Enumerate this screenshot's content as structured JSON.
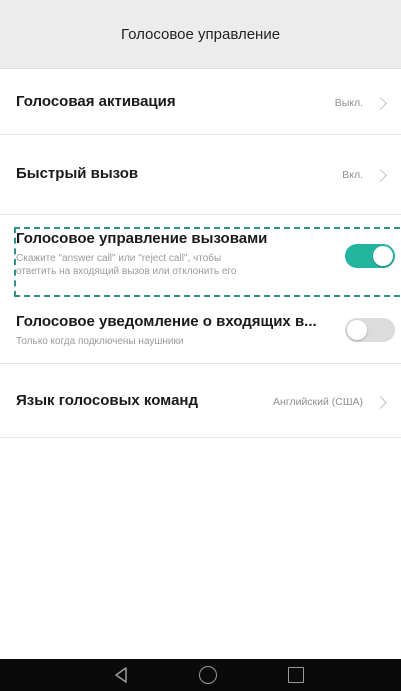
{
  "header": {
    "title": "Голосовое управление"
  },
  "rows": [
    {
      "title": "Голосовая активация",
      "value": "Выкл."
    },
    {
      "title": "Быстрый вызов",
      "value": "Вкл."
    },
    {
      "title": "Голосовое управление вызовами",
      "subtitle_line1": "Скажите \"answer call\" или \"reject call\", чтобы",
      "subtitle_line2": "ответить на входящий вызов или отклонить его",
      "toggle": "on"
    },
    {
      "title": "Голосовое уведомление о входящих в...",
      "subtitle": "Только когда подключены наушники",
      "toggle": "off"
    },
    {
      "title": "Язык голосовых команд",
      "value": "Английский (США)"
    }
  ],
  "colors": {
    "toggle_on": "#24b5a0",
    "toggle_off": "#dcdcdc",
    "highlight_dash": "#2f8f8a"
  },
  "navbar": {
    "icons": [
      "back-icon",
      "home-icon",
      "recent-apps-icon"
    ]
  }
}
